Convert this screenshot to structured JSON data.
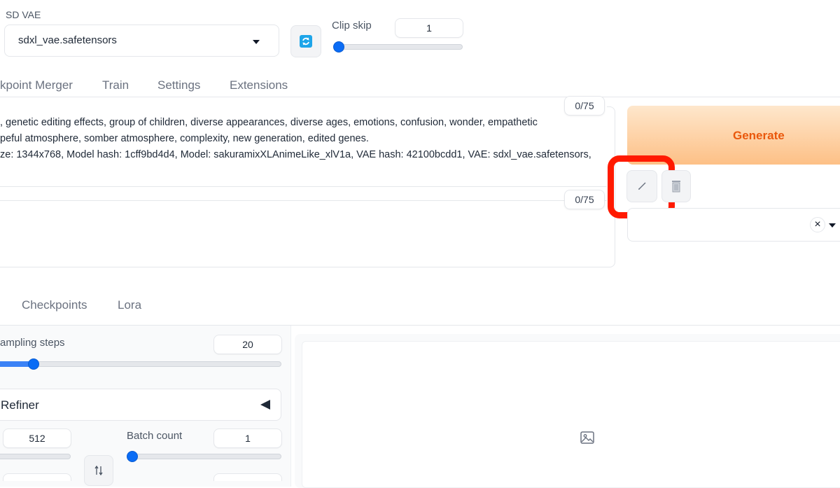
{
  "header": {
    "sd_vae_label": "SD VAE",
    "sd_vae_value": "sdxl_vae.safetensors",
    "clip_skip_label": "Clip skip",
    "clip_skip_value": "1"
  },
  "tabs": [
    "kpoint Merger",
    "Train",
    "Settings",
    "Extensions"
  ],
  "prompt": {
    "counter": "0/75",
    "lines": [
      ", genetic editing effects, group of children, diverse appearances, diverse ages, emotions, confusion, wonder, empathetic",
      "peful atmosphere, somber atmosphere, complexity, new generation, edited genes.",
      "ze: 1344x768, Model hash: 1cff9bd4d4, Model: sakuramixXLAnimeLike_xlV1a, VAE hash: 42100bcdd1, VAE: sdxl_vae.safetensors,"
    ]
  },
  "negative_prompt": {
    "counter": "0/75",
    "value": ""
  },
  "generate": {
    "label": "Generate"
  },
  "styles": {
    "clear_symbol": "×"
  },
  "extra_tabs": [
    "Checkpoints",
    "Lora"
  ],
  "params": {
    "sampling_steps_label": "ampling steps",
    "sampling_steps_value": "20",
    "sampling_steps_fraction": 0.13,
    "refiner_label": "Refiner",
    "width_value": "512",
    "batch_count_label": "Batch count",
    "batch_count_value": "1"
  },
  "icons": {
    "vae_refresh": "refresh-icon",
    "edit": "pencil-icon",
    "trash": "trash-icon",
    "image_placeholder": "image-icon",
    "swap": "swap-icon"
  },
  "colors": {
    "generate_top": "#fde2c3",
    "generate_bottom": "#fdba74",
    "generate_text": "#ea580c",
    "highlight": "#ff1a00",
    "slider": "#0a6cf5"
  }
}
